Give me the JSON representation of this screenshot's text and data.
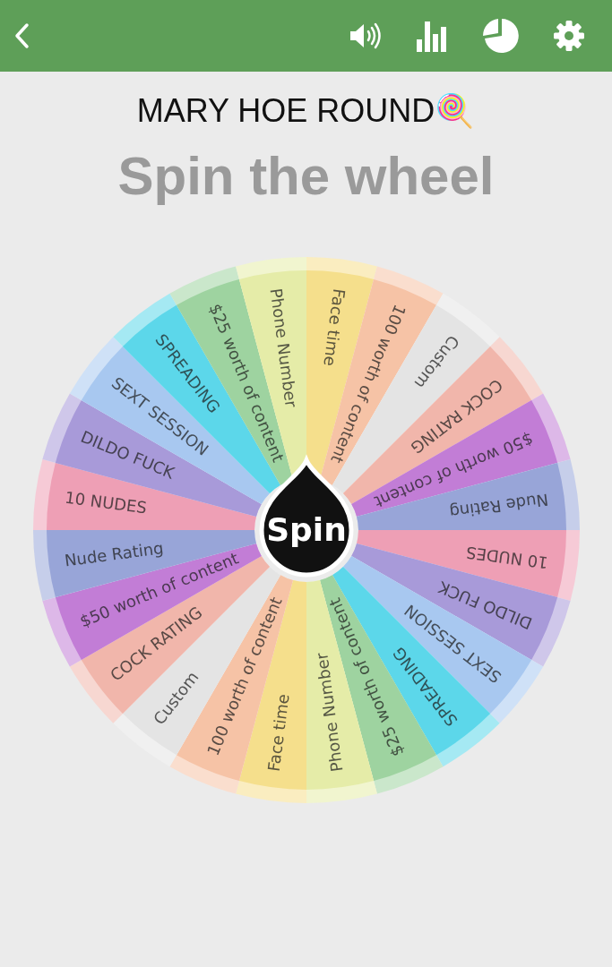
{
  "title": "MARY HOE ROUND🍭",
  "heading": "Spin the wheel",
  "wheel": {
    "segments": [
      {
        "label": "Face time",
        "color": "#f5df8c"
      },
      {
        "label": "100 worth of content",
        "color": "#f6c3a6"
      },
      {
        "label": "Custom",
        "color": "#e4e4e4"
      },
      {
        "label": "COCK RATING",
        "color": "#f1b6ab"
      },
      {
        "label": "$50 worth of content",
        "color": "#c27dd6"
      },
      {
        "label": "Nude Rating",
        "color": "#98a5d8"
      },
      {
        "label": "10 NUDES",
        "color": "#ee9fb5"
      },
      {
        "label": "DILDO FUCK",
        "color": "#a89ad9"
      },
      {
        "label": "SEXT SESSION",
        "color": "#a8c8f0"
      },
      {
        "label": "SPREADING",
        "color": "#5cd7ea"
      },
      {
        "label": "$25 worth of content",
        "color": "#9ed3a0"
      },
      {
        "label": "Phone Number",
        "color": "#e5eca8"
      },
      {
        "label": "Face time",
        "color": "#f5df8c"
      },
      {
        "label": "100 worth of content",
        "color": "#f6c3a6"
      },
      {
        "label": "Custom",
        "color": "#e4e4e4"
      },
      {
        "label": "COCK RATING",
        "color": "#f1b6ab"
      },
      {
        "label": "$50 worth of content",
        "color": "#c27dd6"
      },
      {
        "label": "Nude Rating",
        "color": "#98a5d8"
      },
      {
        "label": "10 NUDES",
        "color": "#ee9fb5"
      },
      {
        "label": "DILDO FUCK",
        "color": "#a89ad9"
      },
      {
        "label": "SEXT SESSION",
        "color": "#a8c8f0"
      },
      {
        "label": "SPREADING",
        "color": "#5cd7ea"
      },
      {
        "label": "$25 worth of content",
        "color": "#9ed3a0"
      },
      {
        "label": "Phone Number",
        "color": "#e5eca8"
      }
    ]
  },
  "spin_button": "Spin"
}
